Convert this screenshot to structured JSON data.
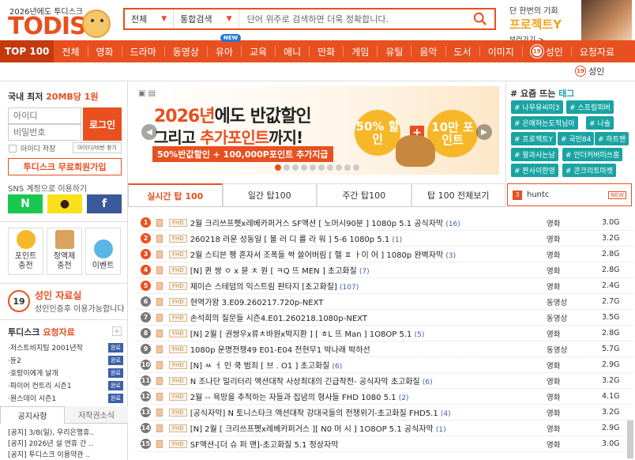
{
  "header": {
    "logo_sub": "2026년에도 투디스크",
    "logo": "TODISK",
    "search": {
      "select1": "전체",
      "select2": "통합검색",
      "placeholder": "단어 위주로 검색하면 더욱 정확합니다."
    },
    "promo": {
      "line1": "단 한번의 기회",
      "line2": "프로젝트Y",
      "line3": "보러가기 >"
    }
  },
  "nav": {
    "items": [
      "TOP 100",
      "전체",
      "영화",
      "드라마",
      "동영상",
      "유아",
      "교육",
      "애니",
      "만화",
      "게임",
      "유틸",
      "음악",
      "도서",
      "이미지",
      "성인",
      "요청자료"
    ],
    "new_badge": "NEW",
    "adult_badge": "19"
  },
  "adult_link": {
    "badge": "19",
    "label": "성인"
  },
  "login": {
    "title_prefix": "국내 최저 ",
    "title_highlight": "20MB당 1원",
    "id_placeholder": "아이디",
    "pw_placeholder": "비밀번호",
    "login_button": "로그인",
    "keep_login": "아이디 저장",
    "find": "아이디/비번 찾기",
    "join": "투디스크 무료회원가입",
    "sns_label": "SNS 계정으로 이용하기",
    "sns": [
      {
        "label": "N",
        "bg": "#19c94f",
        "color": "#fff"
      },
      {
        "label": "●",
        "bg": "#f8e11c",
        "color": "#3b1d1d"
      },
      {
        "label": "f",
        "bg": "#3b5998",
        "color": "#fff"
      }
    ]
  },
  "features": [
    {
      "label1": "포인트",
      "label2": "충전",
      "color": "#f6b828"
    },
    {
      "label1": "정액제",
      "label2": "충전",
      "color": "#d9a35d"
    },
    {
      "label1": "이벤트",
      "label2": "",
      "color": "#5ab6e6"
    }
  ],
  "adult_box": {
    "badge": "19",
    "title": "성인 자료실",
    "desc": "성인인증후 이용가능합니다"
  },
  "requests": {
    "title_prefix": "투디스크 ",
    "title_highlight": "요청자료",
    "done": "완료",
    "items": [
      "·저스트비지팅 2001년작",
      "·듄2",
      "·호랑이에게 날개",
      "·파이어 컨트리 시즌1",
      "·원스데이 시즌1"
    ]
  },
  "notice_tabs": [
    "공지사항",
    "저작권소식"
  ],
  "notices": [
    "[공지] 3/8(일), 우리은행휴..",
    "[공지] 2026년 설 연휴 간 ..",
    "[공지] 투디스크 이용약관 .."
  ],
  "banner": {
    "corner": "▣ ▤",
    "line1a": "2026년",
    "line1b": "에도 반값할인",
    "line2a": "그리고 ",
    "line2b": "추가포인트",
    "line2c": "까지!",
    "line3": "50%반값할인 + 100,000P포인트 추가지급",
    "coin1": "50% 할인",
    "coin2": "10만 포인트",
    "plus": "+"
  },
  "tags": {
    "title_prefix": "# 요즘 뜨는 ",
    "title_highlight": "태그",
    "items": [
      "# 나우유씨미3",
      "# 스프링피버",
      "# 은애하는도적님아",
      "# 나솔",
      "# 프로젝트Y",
      "# 국민84",
      "# 하트맨",
      "# 왕과사는남",
      "# 언더커버미쓰홍",
      "# 판사이한영",
      "# 콘크리트마켓"
    ]
  },
  "tabs": [
    "실시간 탑 100",
    "일간 탑100",
    "주간 탑100",
    "탑 100 전체보기"
  ],
  "hunt": {
    "num": "3",
    "word": "huntc",
    "status": "NEW"
  },
  "hd_label": "FHD",
  "list": [
    {
      "rank": "1",
      "title": "2월 크리쓰프펫x레베카퍼거스 SF액션 [ 노머시90분 ] 1080p 5.1 공식자막",
      "count": "(16)",
      "cat": "영화",
      "size": "3.0G"
    },
    {
      "rank": "2",
      "title": "260218 러운 성동일 [ 볼 러 디 를 라 워 ] 5-6 1080p 5.1",
      "count": "(1)",
      "cat": "영화",
      "size": "3.2G"
    },
    {
      "rank": "3",
      "title": "2월 스티븐 펭 혼자서 조폭들 싹 쓸어버림 [ 헬 ㅍ ㅏ이 어 ] 1080p 완벽자막",
      "count": "(3)",
      "cat": "영화",
      "size": "2.8G"
    },
    {
      "rank": "4",
      "title": "[N] 퀸 쌍 ㅇ x 뮨 ㅊ 원 [ ㅋQ 뜨 MEN ] 초고화질",
      "count": "(7)",
      "cat": "영화",
      "size": "2.8G"
    },
    {
      "rank": "5",
      "title": "제이슨 스테덤의 익스트림 판타지 [초고화질]",
      "count": "(107)",
      "cat": "영화",
      "size": "2.4G"
    },
    {
      "rank": "6",
      "title": "현역가왕 3.E09.260217.720p-NEXT",
      "count": "",
      "cat": "동영상",
      "size": "2.7G"
    },
    {
      "rank": "7",
      "title": "손석희의 질문들 시즌4.E01.260218.1080p-NEXT",
      "count": "",
      "cat": "동영상",
      "size": "3.5G"
    },
    {
      "rank": "8",
      "title": "[N] 2월 [ 권쌍우x류ㅊ바원x박지환 ] [ ㅎL 뜨 Man ] 1O8OP 5.1",
      "count": "(5)",
      "cat": "영화",
      "size": "2.8G"
    },
    {
      "rank": "9",
      "title": "1080p 운명전쟁49 E01-E04 전현무1 박나래 박하선",
      "count": "",
      "cat": "동영상",
      "size": "5.7G"
    },
    {
      "rank": "10",
      "title": "[N] ㅆ ㅓ 인 쿡 범죄 [ 브 . O1 ] 초고화질",
      "count": "(6)",
      "cat": "영화",
      "size": "2.9G"
    },
    {
      "rank": "11",
      "title": "N 조나단 밀리터리 액션대작 사상최대의 긴급작전- 공식자막 초고화질",
      "count": "(6)",
      "cat": "영화",
      "size": "3.2G"
    },
    {
      "rank": "12",
      "title": "2월 -- 욕망을 추적하는 자들과 집념의 형사들 FHD 1080 5.1",
      "count": "(2)",
      "cat": "영화",
      "size": "4.1G"
    },
    {
      "rank": "13",
      "title": "[공식자막] N 토니스타크 액션대작 강대국들의 전쟁위기-초고화질 FHD5.1",
      "count": "(4)",
      "cat": "영화",
      "size": "3.2G"
    },
    {
      "rank": "14",
      "title": "[N] 2월 [ 크리쓰프펫x레베카퍼거스 ][ N0 머 시 ] 1O8OP 5.1 공식자막",
      "count": "(1)",
      "cat": "영화",
      "size": "2.9G"
    },
    {
      "rank": "15",
      "title": "SF액션-[더 슈 퍼 맨]-초고화질 5.1 정상자막",
      "count": "",
      "cat": "영화",
      "size": "3.0G"
    }
  ]
}
